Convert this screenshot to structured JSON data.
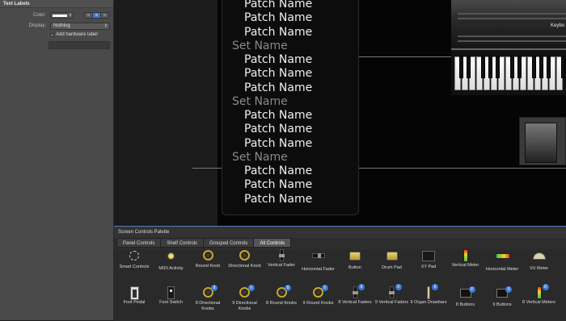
{
  "inspector": {
    "title": "Text Labels",
    "color_label": "Color:",
    "display_label": "Display:",
    "display_value": "Nothing",
    "add_hw_label": "Add hardware label",
    "align_icons": [
      "align-left-icon",
      "align-center-icon",
      "align-right-icon"
    ]
  },
  "patch_list": {
    "rows": [
      {
        "type": "patch",
        "text": "Patch Name"
      },
      {
        "type": "patch",
        "text": "Patch Name"
      },
      {
        "type": "patch",
        "text": "Patch Name"
      },
      {
        "type": "set",
        "text": "Set Name"
      },
      {
        "type": "patch",
        "text": "Patch Name"
      },
      {
        "type": "patch",
        "text": "Patch Name"
      },
      {
        "type": "patch",
        "text": "Patch Name"
      },
      {
        "type": "set",
        "text": "Set Name"
      },
      {
        "type": "patch",
        "text": "Patch Name"
      },
      {
        "type": "patch",
        "text": "Patch Name"
      },
      {
        "type": "patch",
        "text": "Patch Name"
      },
      {
        "type": "set",
        "text": "Set Name"
      },
      {
        "type": "patch",
        "text": "Patch Name"
      },
      {
        "type": "patch",
        "text": "Patch Name"
      },
      {
        "type": "patch",
        "text": "Patch Name"
      }
    ]
  },
  "keyboard": {
    "label": "Keybo"
  },
  "palette": {
    "title": "Screen Controls Palette",
    "tabs": [
      {
        "label": "Panel Controls",
        "active": false
      },
      {
        "label": "Shelf Controls",
        "active": false
      },
      {
        "label": "Grouped Controls",
        "active": false
      },
      {
        "label": "All Controls",
        "active": true
      }
    ],
    "row1": [
      {
        "label": "Smart Controls",
        "icon": "gear-circle"
      },
      {
        "label": "MIDI Activity",
        "icon": "dot-yellow"
      },
      {
        "label": "Round Knob",
        "icon": "knob"
      },
      {
        "label": "Directional Knob",
        "icon": "knob"
      },
      {
        "label": "Vertical Fader",
        "icon": "fader"
      },
      {
        "label": "Horizontal Fader",
        "icon": "hfader"
      },
      {
        "label": "Button",
        "icon": "square-btn"
      },
      {
        "label": "Drum Pad",
        "icon": "square-btn"
      },
      {
        "label": "XY Pad",
        "icon": "xy-pad"
      },
      {
        "label": "Vertical Meter",
        "icon": "vmeter"
      },
      {
        "label": "Horizontal Meter",
        "icon": "hmeter"
      },
      {
        "label": "VU Meter",
        "icon": "vu"
      }
    ],
    "row2": [
      {
        "label": "Foot Pedal",
        "icon": "foot-pedal",
        "badge": ""
      },
      {
        "label": "Foot Switch",
        "icon": "foot-switch",
        "badge": ""
      },
      {
        "label": "8 Directional Knobs",
        "icon": "knob",
        "badge": "8"
      },
      {
        "label": "9 Directional Knobs",
        "icon": "knob",
        "badge": "9"
      },
      {
        "label": "8 Round Knobs",
        "icon": "knob",
        "badge": "8"
      },
      {
        "label": "9 Round Knobs",
        "icon": "knob",
        "badge": "9"
      },
      {
        "label": "8 Vertical Faders",
        "icon": "fader",
        "badge": "8"
      },
      {
        "label": "9 Vertical Faders",
        "icon": "fader",
        "badge": "9"
      },
      {
        "label": "9 Organ Drawbars",
        "icon": "drawbar",
        "badge": "9"
      },
      {
        "label": "8 Buttons",
        "icon": "multi-btn",
        "badge": "8"
      },
      {
        "label": "9 Buttons",
        "icon": "multi-btn",
        "badge": "9"
      },
      {
        "label": "8 Vertical Meters",
        "icon": "vmeter",
        "badge": "8"
      }
    ]
  }
}
